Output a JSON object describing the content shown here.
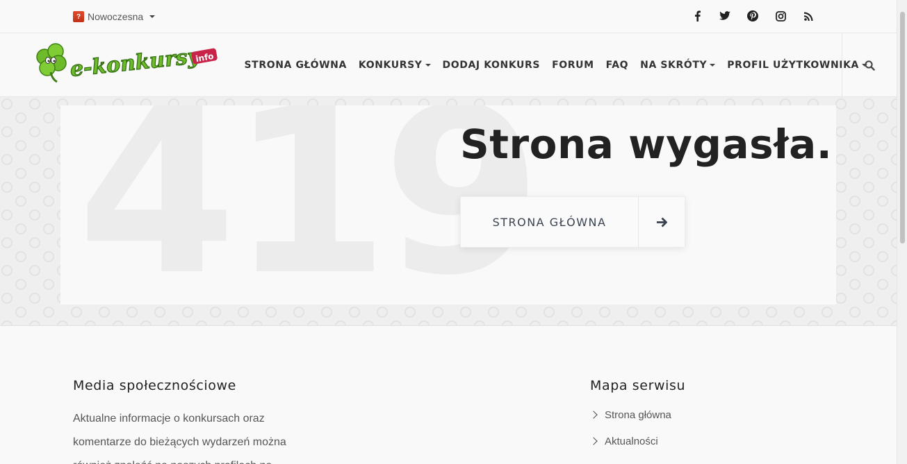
{
  "topbar": {
    "language_flag": "?",
    "language_label": "Nowoczesna",
    "social_icons": [
      "facebook-icon",
      "twitter-icon",
      "pinterest-icon",
      "instagram-icon",
      "rss-icon"
    ]
  },
  "header": {
    "logo_text": "e-konkursy",
    "logo_suffix": "info",
    "nav": [
      {
        "label": "STRONA GŁÓWNA",
        "dropdown": false
      },
      {
        "label": "KONKURSY",
        "dropdown": true
      },
      {
        "label": "DODAJ KONKURS",
        "dropdown": false
      },
      {
        "label": "FORUM",
        "dropdown": false
      },
      {
        "label": "FAQ",
        "dropdown": false
      },
      {
        "label": "NA SKRÓTY",
        "dropdown": true
      },
      {
        "label": "PROFIL UŻYTKOWNIKA",
        "dropdown": true
      }
    ],
    "search_icon": "search-icon"
  },
  "hero": {
    "code": "419",
    "title": "Strona wygasła.",
    "button_label": "STRONA GŁÓWNA",
    "button_icon": "arrow-right-icon"
  },
  "footer": {
    "social_heading": "Media społecznościowe",
    "social_text": "Aktualne informacje o konkursach oraz komentarze do bieżących wydarzeń można również znaleźć na naszych profilach na",
    "sitemap_heading": "Mapa serwisu",
    "sitemap_items": [
      "Strona główna",
      "Aktualności"
    ]
  },
  "colors": {
    "title": "#222222",
    "nav_text": "#333333",
    "button_text": "#3a4250",
    "flag": "#d23c1e",
    "logo_green": "#6dbb2a"
  }
}
